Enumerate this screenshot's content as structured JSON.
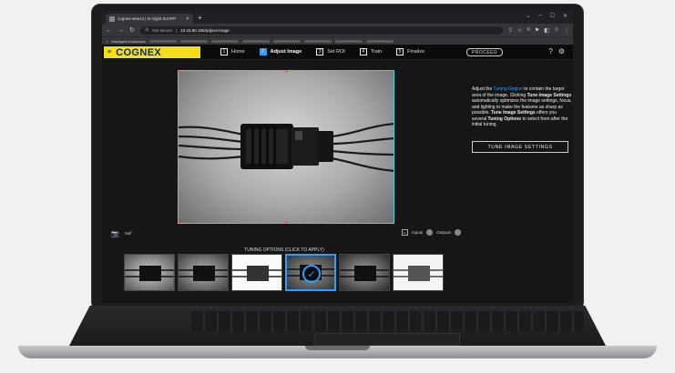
{
  "browser": {
    "tab_title": "cognex-weex2 | In-Sight SnAPP",
    "new_tab": "+",
    "security_label": "Not secure",
    "url": "10.15.80.166/adjust-image",
    "bookmarks_label": "Managed bookmarks"
  },
  "app": {
    "brand": "COGNEX",
    "steps": [
      {
        "num": "1",
        "label": "Home"
      },
      {
        "num": "2",
        "label": "Adjust Image"
      },
      {
        "num": "3",
        "label": "Set ROI"
      },
      {
        "num": "4",
        "label": "Train"
      },
      {
        "num": "5",
        "label": "Finalize"
      }
    ],
    "active_step": 2,
    "proceed_label": "PROCEED"
  },
  "viewer": {
    "trigger_label": "Self",
    "inputs_label": "Inputs",
    "outputs_label": "Outputs",
    "tuning_title": "TUNING OPTIONS (CLICK TO APPLY)",
    "thumbnail_count": 6,
    "selected_thumbnail": 4
  },
  "panel": {
    "t1": "Adjust the ",
    "t2": "Tuning Region",
    "t3": " to contain the target area of the image. Clicking ",
    "t4": "Tune Image Settings",
    "t5": " automatically optimizes the image settings, focus, and lighting to make the features as sharp as possible. ",
    "t6": "Tune Image Settings",
    "t7": " offers you several ",
    "t8": "Tuning Options",
    "t9": " to select from after the initial tuning.",
    "button_label": "TUNE IMAGE SETTINGS"
  },
  "colors": {
    "brand_yellow": "#f5df1b",
    "brand_navy": "#0d2b63",
    "accent_blue": "#2d9fff",
    "roi_cyan": "#3ed3e0"
  }
}
